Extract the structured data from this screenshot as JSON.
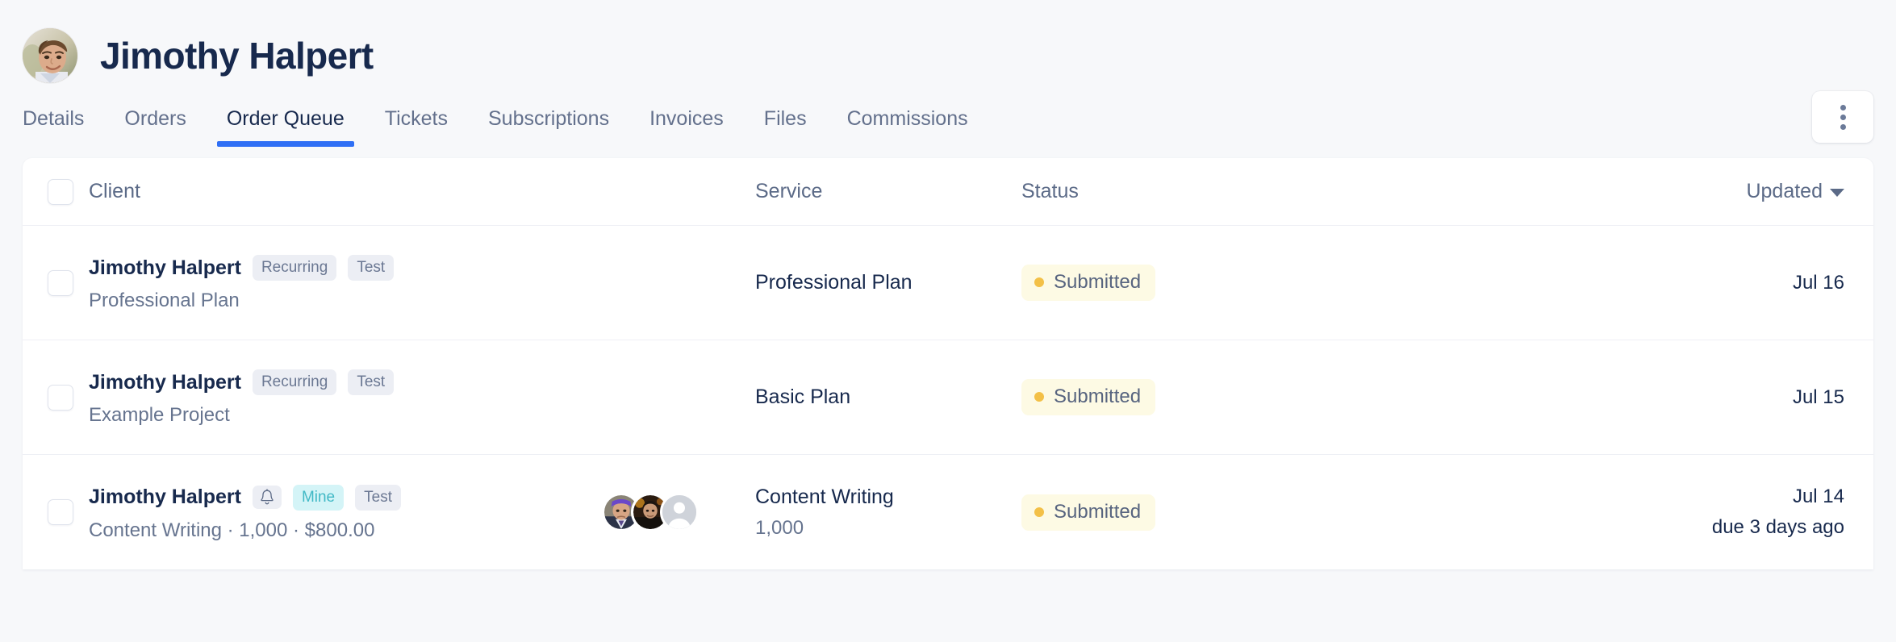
{
  "profile": {
    "name": "Jimothy Halpert",
    "avatar_alt": "user-photo"
  },
  "tabs": [
    {
      "label": "Details",
      "active": false
    },
    {
      "label": "Orders",
      "active": false
    },
    {
      "label": "Order Queue",
      "active": true
    },
    {
      "label": "Tickets",
      "active": false
    },
    {
      "label": "Subscriptions",
      "active": false
    },
    {
      "label": "Invoices",
      "active": false
    },
    {
      "label": "Files",
      "active": false
    },
    {
      "label": "Commissions",
      "active": false
    }
  ],
  "toolbar": {
    "more_menu_label": "more-options"
  },
  "table": {
    "columns": {
      "client": "Client",
      "service": "Service",
      "status": "Status",
      "updated": "Updated"
    },
    "sort": {
      "column": "Updated",
      "direction": "desc"
    },
    "rows": [
      {
        "client_name": "Jimothy Halpert",
        "chips": [
          {
            "label": "Recurring",
            "style": "default"
          },
          {
            "label": "Test",
            "style": "default"
          }
        ],
        "has_bell": false,
        "client_sub": "Professional Plan",
        "assignees": [],
        "service_name": "Professional Plan",
        "service_sub": "",
        "status": "Submitted",
        "updated": "Jul 16",
        "updated_sub": ""
      },
      {
        "client_name": "Jimothy Halpert",
        "chips": [
          {
            "label": "Recurring",
            "style": "default"
          },
          {
            "label": "Test",
            "style": "default"
          }
        ],
        "has_bell": false,
        "client_sub": "Example Project",
        "assignees": [],
        "service_name": "Basic Plan",
        "service_sub": "",
        "status": "Submitted",
        "updated": "Jul 15",
        "updated_sub": ""
      },
      {
        "client_name": "Jimothy Halpert",
        "chips": [
          {
            "label": "Mine",
            "style": "mine"
          },
          {
            "label": "Test",
            "style": "default"
          }
        ],
        "has_bell": true,
        "client_sub": "Content Writing · 1,000 · $800.00",
        "assignees": [
          "avatar-bandana",
          "avatar-dark",
          "avatar-placeholder"
        ],
        "service_name": "Content Writing",
        "service_sub": "1,000",
        "status": "Submitted",
        "updated": "Jul 14",
        "updated_sub": "due 3 days ago"
      }
    ]
  },
  "colors": {
    "page_bg": "#f7f8fa",
    "card_bg": "#ffffff",
    "accent_blue": "#2f6ff5",
    "text_dark": "#17294d",
    "text_muted": "#66748f",
    "chip_bg": "#eceef4",
    "chip_mine_bg": "#d4f4f7",
    "chip_mine_text": "#42b9c6",
    "status_bg": "#fdfae4",
    "status_dot": "#f3c047",
    "divider": "#eef0f5"
  }
}
